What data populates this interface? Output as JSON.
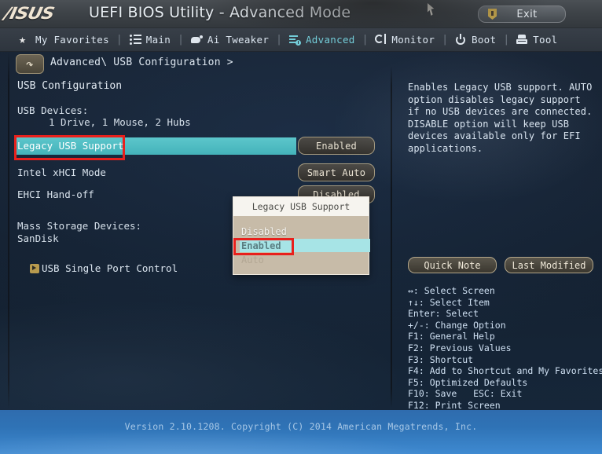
{
  "titlebar": {
    "brand": "/ISUS",
    "title": "UEFI BIOS Utility - Advanced Mode",
    "exit_label": "Exit",
    "exit_icon": "shield-exit-icon"
  },
  "menubar": {
    "items": [
      {
        "label": "My Favorites",
        "icon": "star-icon",
        "active": false
      },
      {
        "label": "Main",
        "icon": "list-icon",
        "active": false
      },
      {
        "label": "Ai Tweaker",
        "icon": "tweaker-icon",
        "active": false
      },
      {
        "label": "Advanced",
        "icon": "sliders-icon",
        "active": true
      },
      {
        "label": "Monitor",
        "icon": "gauge-icon",
        "active": false
      },
      {
        "label": "Boot",
        "icon": "power-icon",
        "active": false
      },
      {
        "label": "Tool",
        "icon": "toolbox-icon",
        "active": false
      }
    ],
    "separator": "|"
  },
  "breadcrumb": {
    "back_icon": "back-arrow-icon",
    "path": "Advanced\\ USB Configuration >"
  },
  "main": {
    "section_title": "USB Configuration",
    "devices_label": "USB Devices:",
    "devices_value": "1 Drive, 1 Mouse, 2 Hubs",
    "settings": [
      {
        "name": "Legacy USB Support",
        "value": "Enabled",
        "selected": true
      },
      {
        "name": "Intel xHCI Mode",
        "value": "Smart Auto",
        "selected": false
      },
      {
        "name": "EHCI Hand-off",
        "value": "Disabled",
        "selected": false
      }
    ],
    "mass_storage_label": "Mass Storage Devices:",
    "mass_storage_value": "SanDisk",
    "port_control_label": "USB Single Port Control",
    "port_control_icon": "submenu-arrow-icon"
  },
  "popup": {
    "title": "Legacy USB Support",
    "options": [
      {
        "label": "Disabled",
        "selected": false
      },
      {
        "label": "Enabled",
        "selected": true
      },
      {
        "label": "Auto",
        "selected": false
      }
    ]
  },
  "help": {
    "text": "Enables Legacy USB support. AUTO option disables legacy support if no USB devices are connected. DISABLE option will keep USB devices available only for EFI applications.",
    "buttons": [
      {
        "label": "Quick Note"
      },
      {
        "label": "Last Modified"
      }
    ],
    "keys": [
      "↔: Select Screen",
      "↑↓: Select Item",
      "Enter: Select",
      "+/-: Change Option",
      "F1: General Help",
      "F2: Previous Values",
      "F3: Shortcut",
      "F4: Add to Shortcut and My Favorites",
      "F5: Optimized Defaults",
      "F10: Save   ESC: Exit",
      "F12: Print Screen"
    ]
  },
  "footer": {
    "text": "Version 2.10.1208. Copyright (C) 2014 American Megatrends, Inc."
  },
  "colors": {
    "highlight_cyan": "#4FBEC3",
    "popup_highlight": "#A7E4E6",
    "accent_teal": "#73CCD8",
    "annotation_red": "#E8201C",
    "footer_blue": "#3079BD",
    "button_border_tan": "#A4997E"
  }
}
